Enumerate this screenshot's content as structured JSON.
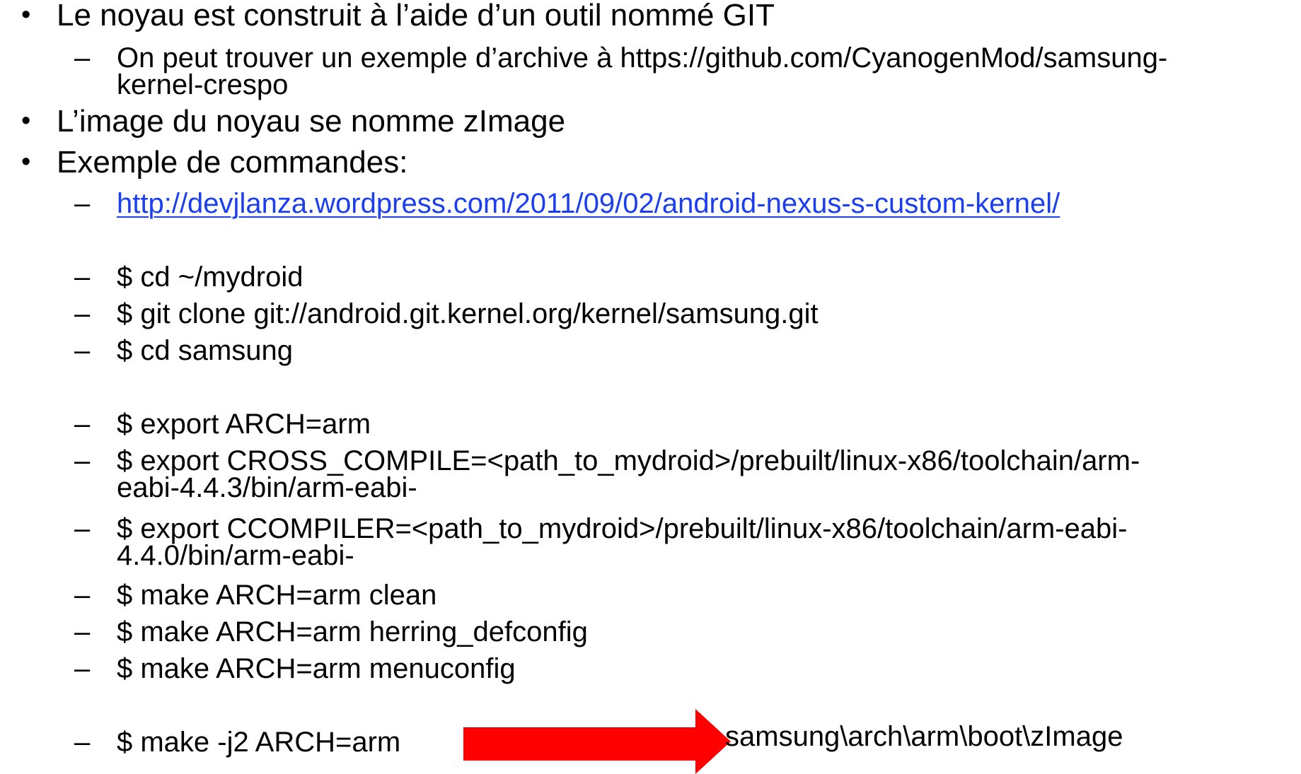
{
  "bullets": [
    "Le noyau est construit à l’aide d’un outil nommé GIT",
    "L’image du noyau se nomme zImage",
    "Exemple de commandes:"
  ],
  "sub": {
    "archive_line1": "On peut trouver un exemple d’archive à https://github.com/CyanogenMod/samsung-",
    "archive_line2": "kernel-crespo",
    "link": "http://devjlanza.wordpress.com/2011/09/02/android-nexus-s-custom-kernel/",
    "cmd_cd_mydroid": "$ cd ~/mydroid",
    "cmd_git_clone": "$ git clone git://android.git.kernel.org/kernel/samsung.git",
    "cmd_cd_samsung": "$ cd samsung",
    "cmd_export_arch": "$ export ARCH=arm",
    "cmd_cross_line1": "$ export CROSS_COMPILE=<path_to_mydroid>/prebuilt/linux-x86/toolchain/arm-",
    "cmd_cross_line2": "eabi-4.4.3/bin/arm-eabi-",
    "cmd_ccomp_line1": "$ export CCOMPILER=<path_to_mydroid>/prebuilt/linux-x86/toolchain/arm-eabi-",
    "cmd_ccomp_line2": "4.4.0/bin/arm-eabi-",
    "cmd_make_clean": "$ make ARCH=arm clean",
    "cmd_make_defconfig": "$ make ARCH=arm herring_defconfig",
    "cmd_make_menuconfig": "$ make ARCH=arm menuconfig",
    "cmd_make_j2": "$ make -j2 ARCH=arm"
  },
  "dash_glyph": "–",
  "bullet_glyph": "•",
  "output_path": "samsung\\arch\\arm\\boot\\zImage",
  "colors": {
    "link": "#1a3ef0",
    "arrow": "#ff0000"
  }
}
